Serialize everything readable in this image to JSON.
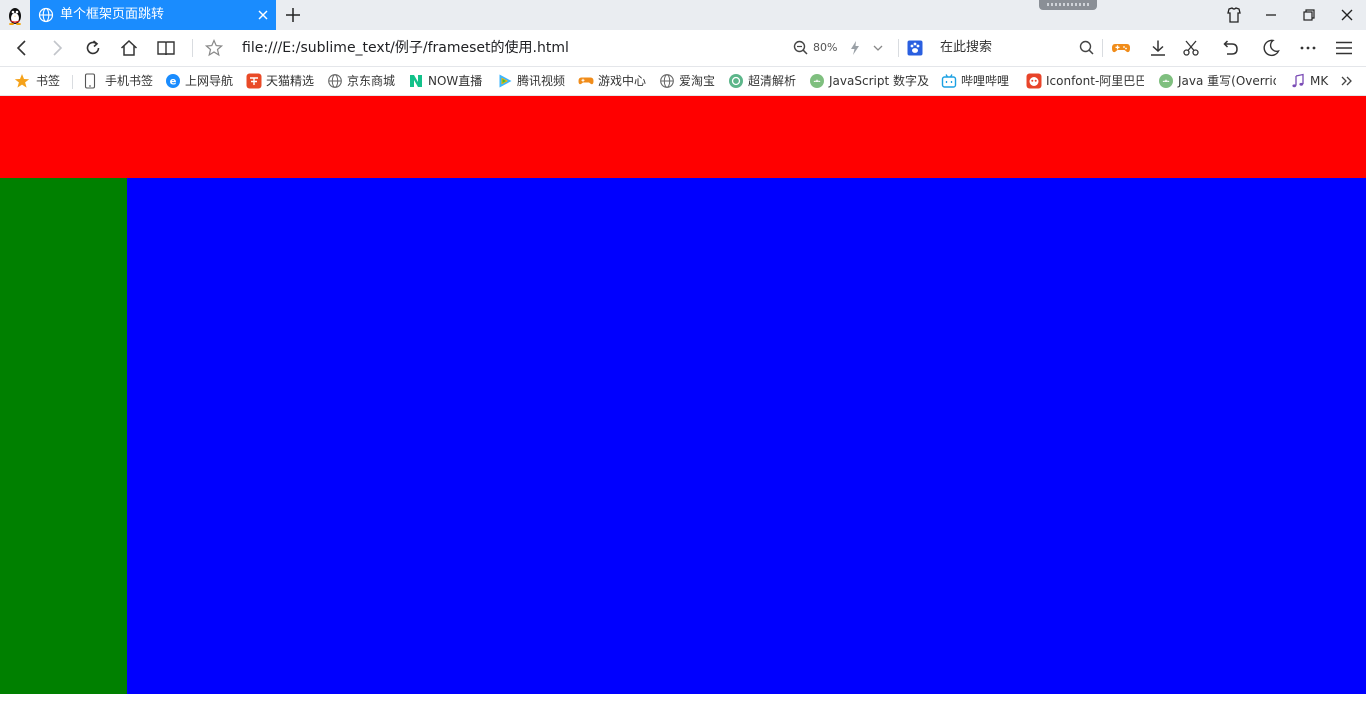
{
  "tab": {
    "title": "单个框架页面跳转"
  },
  "toolbar": {
    "url": "file:///E:/sublime_text/例子/frameset的使用.html",
    "zoom": "80%",
    "search_placeholder": "在此搜索"
  },
  "bookmarks": [
    {
      "label": "书签",
      "icon": "star-icon"
    },
    {
      "label": "手机书签",
      "icon": "phone-icon"
    },
    {
      "label": "上网导航",
      "icon": "ie-icon"
    },
    {
      "label": "天猫精选",
      "icon": "tmall-icon"
    },
    {
      "label": "京东商城",
      "icon": "globe-icon"
    },
    {
      "label": "NOW直播",
      "icon": "now-icon"
    },
    {
      "label": "腾讯视频",
      "icon": "tencent-video-icon"
    },
    {
      "label": "游戏中心",
      "icon": "gamepad-icon"
    },
    {
      "label": "爱淘宝",
      "icon": "globe-icon"
    },
    {
      "label": "超清解析",
      "icon": "green-circle-icon"
    },
    {
      "label": "JavaScript 数字及",
      "icon": "android-icon"
    },
    {
      "label": "哔哩哔哩",
      "icon": "bilibili-icon"
    },
    {
      "label": "Iconfont-阿里巴巴",
      "icon": "iconfont-icon"
    },
    {
      "label": "Java 重写(Override",
      "icon": "android-icon"
    },
    {
      "label": "MK",
      "icon": "music-icon"
    }
  ],
  "frames": {
    "top_color": "#ff0000",
    "left_color": "#008000",
    "main_color": "#0000ff"
  },
  "colors": {
    "tab_active": "#1a8cfe",
    "titlebar": "#eaedf1"
  }
}
